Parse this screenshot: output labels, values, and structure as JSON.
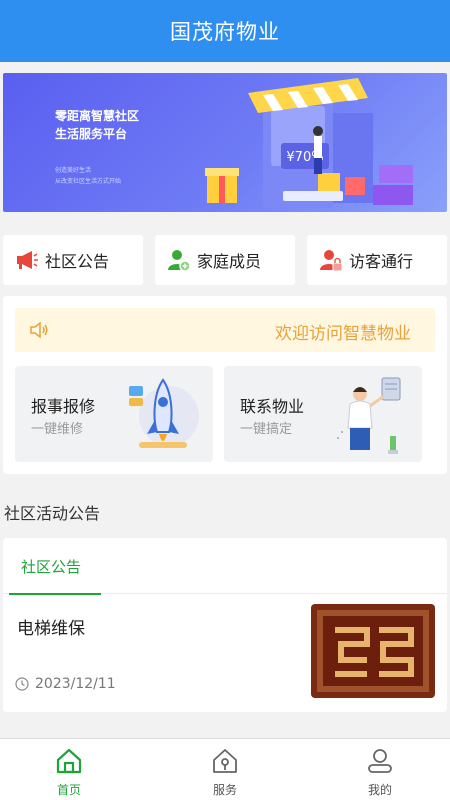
{
  "header": {
    "title": "国茂府物业"
  },
  "banner": {
    "slogan_line1": "零距离智慧社区",
    "slogan_line2": "生活服务平台",
    "sub_line1": "创造美好生活",
    "sub_line2": "从改变社区生活方式开始",
    "discount_text": "¥70%"
  },
  "quick_actions": [
    {
      "label": "社区公告",
      "icon": "megaphone-icon"
    },
    {
      "label": "家庭成员",
      "icon": "family-member-icon"
    },
    {
      "label": "访客通行",
      "icon": "visitor-pass-icon"
    }
  ],
  "notice": {
    "text": "欢迎访问智慧物业",
    "icon": "speaker-icon"
  },
  "services": [
    {
      "title": "报事报修",
      "subtitle": "一键维修",
      "icon": "rocket-illustration"
    },
    {
      "title": "联系物业",
      "subtitle": "一键搞定",
      "icon": "person-illustration"
    }
  ],
  "section": {
    "title": "社区活动公告"
  },
  "news": {
    "tab": "社区公告",
    "items": [
      {
        "title": "电梯维保",
        "date": "2023/12/11",
        "date_icon": "clock-icon"
      }
    ]
  },
  "bottom_nav": [
    {
      "label": "首页",
      "icon": "home-icon",
      "active": true
    },
    {
      "label": "服务",
      "icon": "service-icon",
      "active": false
    },
    {
      "label": "我的",
      "icon": "user-icon",
      "active": false
    }
  ],
  "colors": {
    "primary": "#2f8ff0",
    "accent_green": "#22a33a",
    "notice_text": "#e7a23c"
  }
}
